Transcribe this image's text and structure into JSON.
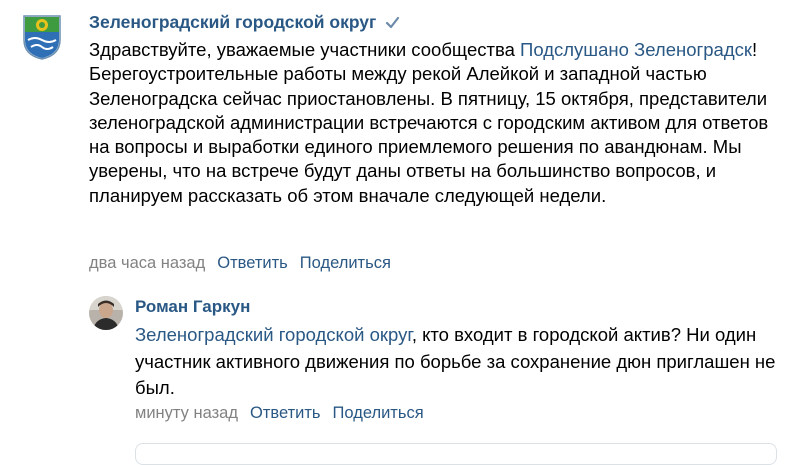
{
  "post": {
    "author": "Зеленоградский городской округ",
    "text_mention": "Подслушано Зеленоградск",
    "text_before": "Здравствуйте, уважаемые участники сообщества ",
    "text_after": "! Берегоустроительные работы между рекой Алейкой и западной частью Зеленоградска сейчас приостановлены. В пятницу, 15 октября, представители зеленоградской администрации встречаются с городским активом для ответов на вопросы и выработки единого приемлемого решения по авандюнам. Мы уверены, что на встрече будут даны ответы на большинство вопросов, и планируем рассказать об этом вначале следующей недели.",
    "time": "два часа назад",
    "reply_label": "Ответить",
    "share_label": "Поделиться"
  },
  "reply": {
    "author": "Роман Гаркун",
    "text_mention": "Зеленоградский городской округ",
    "text_after": ", кто входит в городской актив? Ни один участник активного движения по борьбе за сохранение дюн приглашен не был.",
    "time": "минуту назад",
    "reply_label": "Ответить",
    "share_label": "Поделиться"
  },
  "icons": {
    "verified": "checkmark-icon"
  },
  "colors": {
    "link": "#2a5885",
    "meta": "#828282",
    "text": "#000000"
  }
}
